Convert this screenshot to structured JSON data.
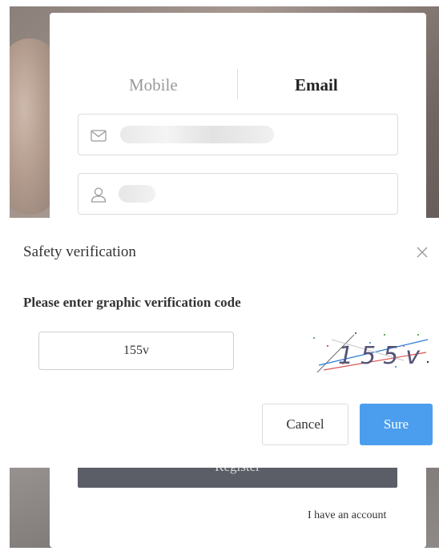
{
  "register_form": {
    "tabs": [
      {
        "label": "Mobile",
        "active": false
      },
      {
        "label": "Email",
        "active": true
      }
    ],
    "email_icon": "envelope-icon",
    "user_icon": "user-icon",
    "register_button": "Register",
    "have_account_link": "I have an account"
  },
  "dialog": {
    "title": "Safety verification",
    "close_icon": "close-icon",
    "prompt": "Please enter graphic verification code",
    "code_value": "155v",
    "captcha_text": "155v",
    "cancel_label": "Cancel",
    "sure_label": "Sure"
  },
  "colors": {
    "primary": "#4b9eee",
    "register_button": "#5b5e66",
    "border": "#dcdcdc",
    "text": "#333333"
  }
}
